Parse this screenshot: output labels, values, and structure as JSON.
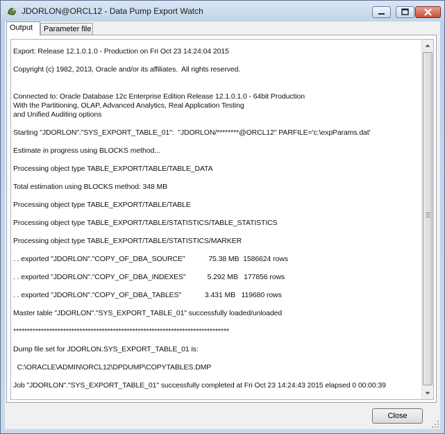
{
  "window": {
    "title": "JDORLON@ORCL12 - Data Pump Export Watch"
  },
  "tabs": [
    {
      "label": "Output",
      "active": true
    },
    {
      "label": "Parameter file",
      "active": false
    }
  ],
  "log": {
    "lines": [
      "Export: Release 12.1.0.1.0 - Production on Fri Oct 23 14:24:04 2015",
      "Copyright (c) 1982, 2013, Oracle and/or its affiliates.  All rights reserved.",
      "Connected to: Oracle Database 12c Enterprise Edition Release 12.1.0.1.0 - 64bit Production",
      "With the Partitioning, OLAP, Advanced Analytics, Real Application Testing",
      "and Unified Auditing options",
      "Starting \"JDORLON\".\"SYS_EXPORT_TABLE_01\":  \"JDORLON/********@ORCL12\" PARFILE='c:\\expParams.dat'",
      "Estimate in progress using BLOCKS method...",
      "Processing object type TABLE_EXPORT/TABLE/TABLE_DATA",
      "Total estimation using BLOCKS method: 348 MB",
      "Processing object type TABLE_EXPORT/TABLE/TABLE",
      "Processing object type TABLE_EXPORT/TABLE/STATISTICS/TABLE_STATISTICS",
      "Processing object type TABLE_EXPORT/TABLE/STATISTICS/MARKER",
      ". . exported \"JDORLON\".\"COPY_OF_DBA_SOURCE\"            75.38 MB  1586624 rows",
      ". . exported \"JDORLON\".\"COPY_OF_DBA_INDEXES\"           5.292 MB   177856 rows",
      ". . exported \"JDORLON\".\"COPY_OF_DBA_TABLES\"            3.431 MB   119680 rows",
      "Master table \"JDORLON\".\"SYS_EXPORT_TABLE_01\" successfully loaded/unloaded",
      "******************************************************************************",
      "Dump file set for JDORLON.SYS_EXPORT_TABLE_01 is:",
      "  C:\\ORACLE\\ADMIN\\ORCL12\\DPDUMP\\COPYTABLES.DMP",
      "Job \"JDORLON\".\"SYS_EXPORT_TABLE_01\" successfully completed at Fri Oct 23 14:24:43 2015 elapsed 0 00:00:39"
    ]
  },
  "buttons": {
    "close_label": "Close"
  },
  "icons": {
    "app": "app-icon",
    "minimize": "minimize-icon",
    "maximize": "maximize-icon",
    "close": "close-icon"
  }
}
